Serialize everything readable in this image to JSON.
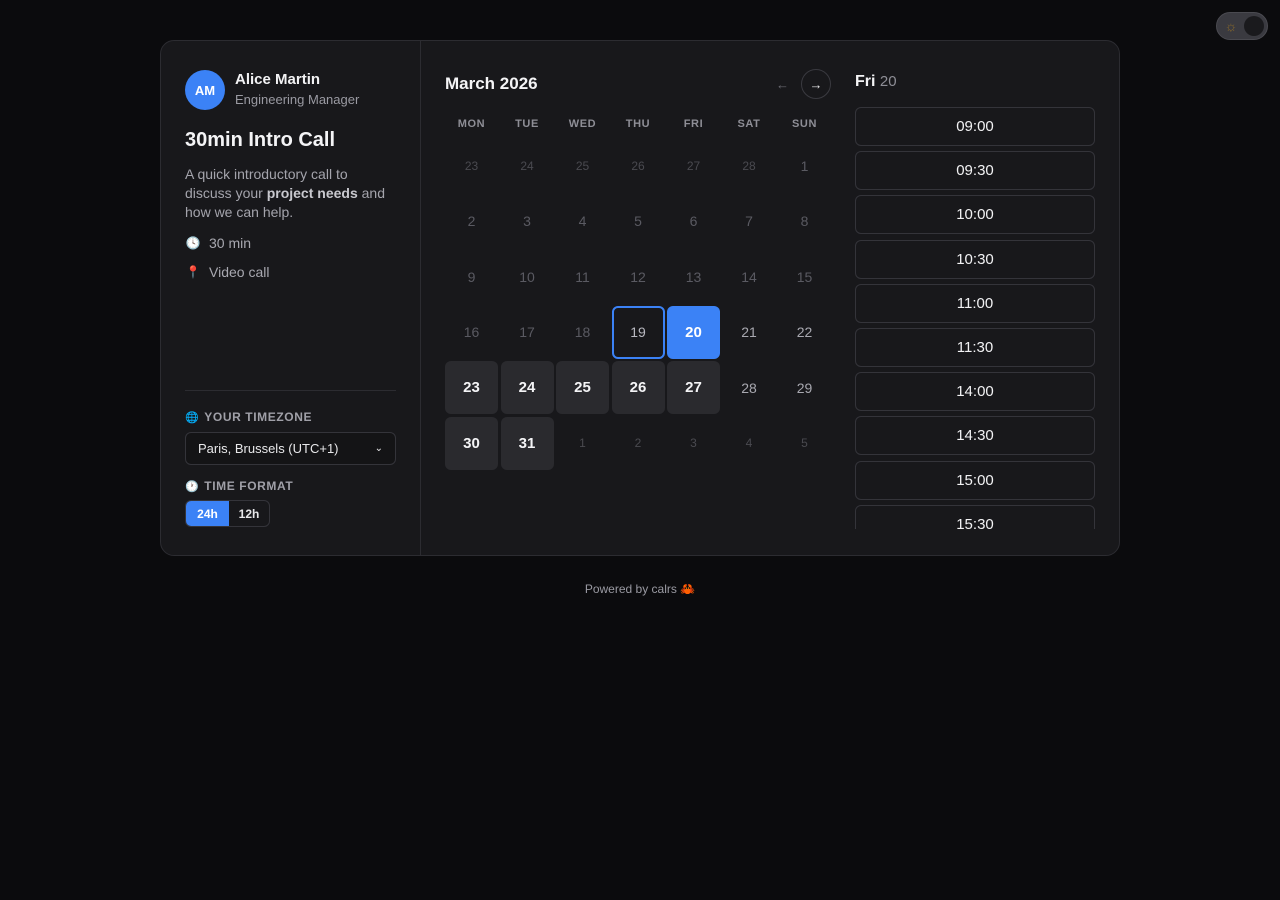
{
  "theme_toggle": {
    "icon": "sun-icon"
  },
  "host": {
    "initials": "AM",
    "name": "Alice Martin",
    "role": "Engineering Manager"
  },
  "event": {
    "title": "30min Intro Call",
    "description_before": "A quick introductory call to discuss your ",
    "description_bold": "project needs",
    "description_after": " and how we can help.",
    "duration": "30 min",
    "location": "Video call"
  },
  "timezone": {
    "label": "YOUR TIMEZONE",
    "value": "Paris, Brussels (UTC+1)"
  },
  "time_format": {
    "label": "TIME FORMAT",
    "options": [
      "24h",
      "12h"
    ],
    "selected": "24h"
  },
  "calendar": {
    "month_label": "March 2026",
    "prev": "←",
    "next": "→",
    "weekdays": [
      "MON",
      "TUE",
      "WED",
      "THU",
      "FRI",
      "SAT",
      "SUN"
    ],
    "days": [
      {
        "d": "23",
        "s": "other"
      },
      {
        "d": "24",
        "s": "other"
      },
      {
        "d": "25",
        "s": "other"
      },
      {
        "d": "26",
        "s": "other"
      },
      {
        "d": "27",
        "s": "other"
      },
      {
        "d": "28",
        "s": "other"
      },
      {
        "d": "1",
        "s": "past"
      },
      {
        "d": "2",
        "s": "past"
      },
      {
        "d": "3",
        "s": "past"
      },
      {
        "d": "4",
        "s": "past"
      },
      {
        "d": "5",
        "s": "past"
      },
      {
        "d": "6",
        "s": "past"
      },
      {
        "d": "7",
        "s": "past"
      },
      {
        "d": "8",
        "s": "past"
      },
      {
        "d": "9",
        "s": "past"
      },
      {
        "d": "10",
        "s": "past"
      },
      {
        "d": "11",
        "s": "past"
      },
      {
        "d": "12",
        "s": "past"
      },
      {
        "d": "13",
        "s": "past"
      },
      {
        "d": "14",
        "s": "past"
      },
      {
        "d": "15",
        "s": "past"
      },
      {
        "d": "16",
        "s": "past"
      },
      {
        "d": "17",
        "s": "past"
      },
      {
        "d": "18",
        "s": "past"
      },
      {
        "d": "19",
        "s": "today"
      },
      {
        "d": "20",
        "s": "selected"
      },
      {
        "d": "21",
        "s": "future"
      },
      {
        "d": "22",
        "s": "future"
      },
      {
        "d": "23",
        "s": "avail"
      },
      {
        "d": "24",
        "s": "avail"
      },
      {
        "d": "25",
        "s": "avail"
      },
      {
        "d": "26",
        "s": "avail"
      },
      {
        "d": "27",
        "s": "avail"
      },
      {
        "d": "28",
        "s": "future"
      },
      {
        "d": "29",
        "s": "future"
      },
      {
        "d": "30",
        "s": "avail"
      },
      {
        "d": "31",
        "s": "avail"
      },
      {
        "d": "1",
        "s": "other"
      },
      {
        "d": "2",
        "s": "other"
      },
      {
        "d": "3",
        "s": "other"
      },
      {
        "d": "4",
        "s": "other"
      },
      {
        "d": "5",
        "s": "other"
      }
    ]
  },
  "slots": {
    "day": "Fri",
    "date": "20",
    "times": [
      "09:00",
      "09:30",
      "10:00",
      "10:30",
      "11:00",
      "11:30",
      "14:00",
      "14:30",
      "15:00",
      "15:30"
    ]
  },
  "footer": {
    "text": "Powered by calrs",
    "emoji": "🦀"
  },
  "colors": {
    "accent": "#3b82f6",
    "background": "#0b0b0d",
    "card": "#18181b"
  }
}
